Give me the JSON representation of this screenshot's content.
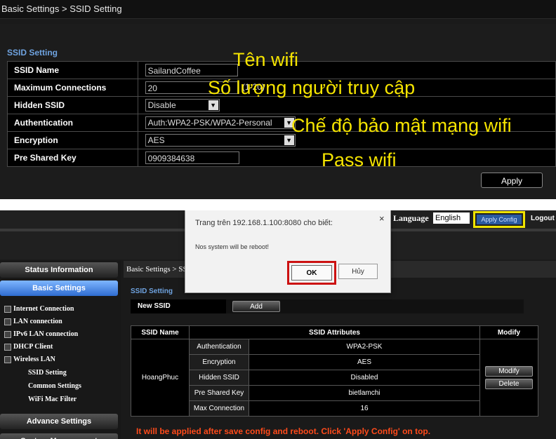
{
  "top": {
    "breadcrumb": "Basic Settings > SSID Setting",
    "section_title": "SSID Setting",
    "rows": [
      {
        "label": "SSID Name",
        "value": "SailandCoffee"
      },
      {
        "label": "Maximum Connections",
        "value": "20",
        "suffix": "(1-20)"
      },
      {
        "label": "Hidden SSID",
        "value": "Disable"
      },
      {
        "label": "Authentication",
        "value": "Auth:WPA2-PSK/WPA2-Personal"
      },
      {
        "label": "Encryption",
        "value": "AES"
      },
      {
        "label": "Pre Shared Key",
        "value": "0909384638"
      }
    ],
    "apply_label": "Apply",
    "annotations": {
      "wifi_name": "Tên wifi",
      "user_count": "Số lượng người truy cập",
      "security_mode": "Chế độ bảo mật mạng wifi",
      "wifi_pass": "Pass wifi"
    },
    "annotation_color": "#f5e400"
  },
  "bottom": {
    "header": {
      "language_label": "Language",
      "language_value": "English",
      "apply_config": "Apply Config",
      "logout": "Logout"
    },
    "sidebar": {
      "status_information": "Status Information",
      "basic_settings": "Basic Settings",
      "items": [
        "Internet Connection",
        "LAN connection",
        "IPv6 LAN connection",
        "DHCP Client",
        "Wireless LAN"
      ],
      "subitems": [
        "SSID Setting",
        "Common Settings",
        "WiFi Mac Filter"
      ],
      "advance_settings": "Advance Settings",
      "system_management": "System Management"
    },
    "main": {
      "breadcrumb": "Basic Settings > SS",
      "section_title": "SSID Setting",
      "new_ssid_label": "New SSID",
      "add_label": "Add",
      "table": {
        "headers": [
          "SSID Name",
          "SSID Attributes",
          "Modify"
        ],
        "ssid_name": "HoangPhuc",
        "attributes": [
          {
            "name": "Authentication",
            "value": "WPA2-PSK"
          },
          {
            "name": "Encryption",
            "value": "AES"
          },
          {
            "name": "Hidden SSID",
            "value": "Disabled"
          },
          {
            "name": "Pre Shared Key",
            "value": "bietlamchi"
          },
          {
            "name": "Max Connection",
            "value": "16"
          }
        ],
        "modify_label": "Modify",
        "delete_label": "Delete"
      },
      "note": "It will be applied after save config and reboot. Click 'Apply Config' on top."
    },
    "dialog": {
      "title": "Trang trên 192.168.1.100:8080 cho biết:",
      "close": "×",
      "message": "Nos system will be reboot!",
      "ok_label": "OK",
      "cancel_label": "Hủy"
    }
  }
}
